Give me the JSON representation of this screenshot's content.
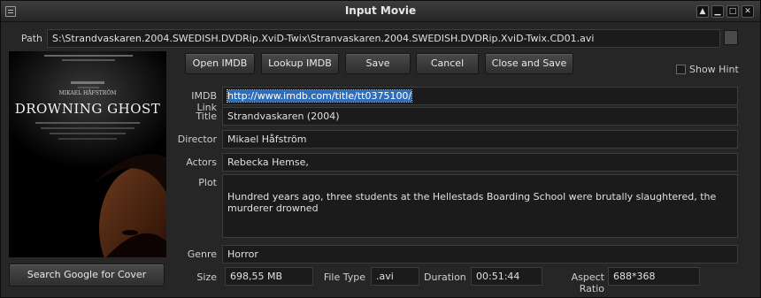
{
  "window": {
    "title": "Input Movie"
  },
  "path": {
    "label": "Path",
    "value": "S:\\Strandvaskaren.2004.SWEDISH.DVDRip.XviD-Twix\\Stranvaskaren.2004.SWEDISH.DVDRip.XviD-Twix.CD01.avi"
  },
  "toolbar": {
    "open_imdb": "Open IMDB",
    "lookup_imdb": "Lookup IMDB",
    "save": "Save",
    "cancel": "Cancel",
    "close_and_save": "Close and Save",
    "show_hint": "Show Hint",
    "show_hint_checked": false
  },
  "poster": {
    "credit_line": "MIKAEL HÅFSTRÖM",
    "title_line": "DROWNING GHOST"
  },
  "search_cover_label": "Search Google for  Cover",
  "fields": {
    "imdb_link_label": "IMDB Link",
    "imdb_link": "http://www.imdb.com/title/tt0375100/",
    "title_label": "Title",
    "title": "Strandvaskaren (2004)",
    "director_label": "Director",
    "director": "Mikael Håfström",
    "actors_label": "Actors",
    "actors": "Rebecka Hemse,",
    "plot_label": "Plot",
    "plot": "Hundred years ago, three students at the Hellestads Boarding School were brutally slaughtered, the murderer drowned",
    "genre_label": "Genre",
    "genre": "Horror",
    "size_label": "Size",
    "size": "698,55 MB",
    "file_type_label": "File Type",
    "file_type": ".avi",
    "duration_label": "Duration",
    "duration": "00:51:44",
    "aspect_ratio_label": "Aspect Ratio",
    "aspect_ratio": "688*368"
  }
}
